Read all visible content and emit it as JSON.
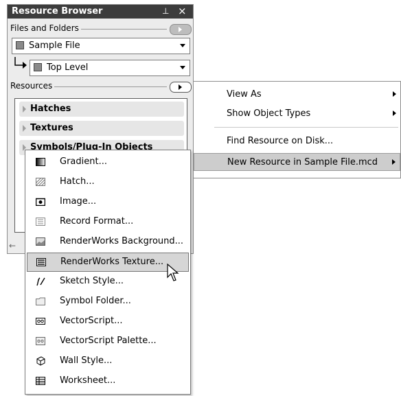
{
  "palette": {
    "title": "Resource Browser",
    "pin_glyph": "ᵖ",
    "close_glyph": "×",
    "files_section_label": "Files and Folders",
    "file_combo_value": "Sample File",
    "folder_combo_value": "Top Level",
    "resources_section_label": "Resources",
    "resource_categories": [
      "Hatches",
      "Textures",
      "Symbols/Plug-In Objects"
    ]
  },
  "context_menu": {
    "items": [
      {
        "label": "View As",
        "submenu": true
      },
      {
        "label": "Show Object Types",
        "submenu": true
      },
      {
        "label": "Find Resource on Disk...",
        "submenu": false
      },
      {
        "label": "New Resource in Sample File.mcd",
        "submenu": true,
        "highlighted": true
      }
    ]
  },
  "new_resource_submenu": {
    "items": [
      {
        "label": "Gradient...",
        "icon": "gradient-icon"
      },
      {
        "label": "Hatch...",
        "icon": "hatch-icon"
      },
      {
        "label": "Image...",
        "icon": "image-icon"
      },
      {
        "label": "Record Format...",
        "icon": "record-format-icon"
      },
      {
        "label": "RenderWorks Background...",
        "icon": "renderworks-background-icon"
      },
      {
        "label": "RenderWorks Texture...",
        "icon": "renderworks-texture-icon",
        "highlighted": true
      },
      {
        "label": "Sketch Style...",
        "icon": "sketch-style-icon"
      },
      {
        "label": "Symbol Folder...",
        "icon": "symbol-folder-icon"
      },
      {
        "label": "VectorScript...",
        "icon": "vectorscript-icon"
      },
      {
        "label": "VectorScript Palette...",
        "icon": "vectorscript-palette-icon"
      },
      {
        "label": "Wall Style...",
        "icon": "wall-style-icon"
      },
      {
        "label": "Worksheet...",
        "icon": "worksheet-icon"
      }
    ]
  },
  "colors": {
    "titlebar": "#3c3c3c",
    "palette_bg": "#ececec",
    "highlight": "#d6d6d6"
  }
}
